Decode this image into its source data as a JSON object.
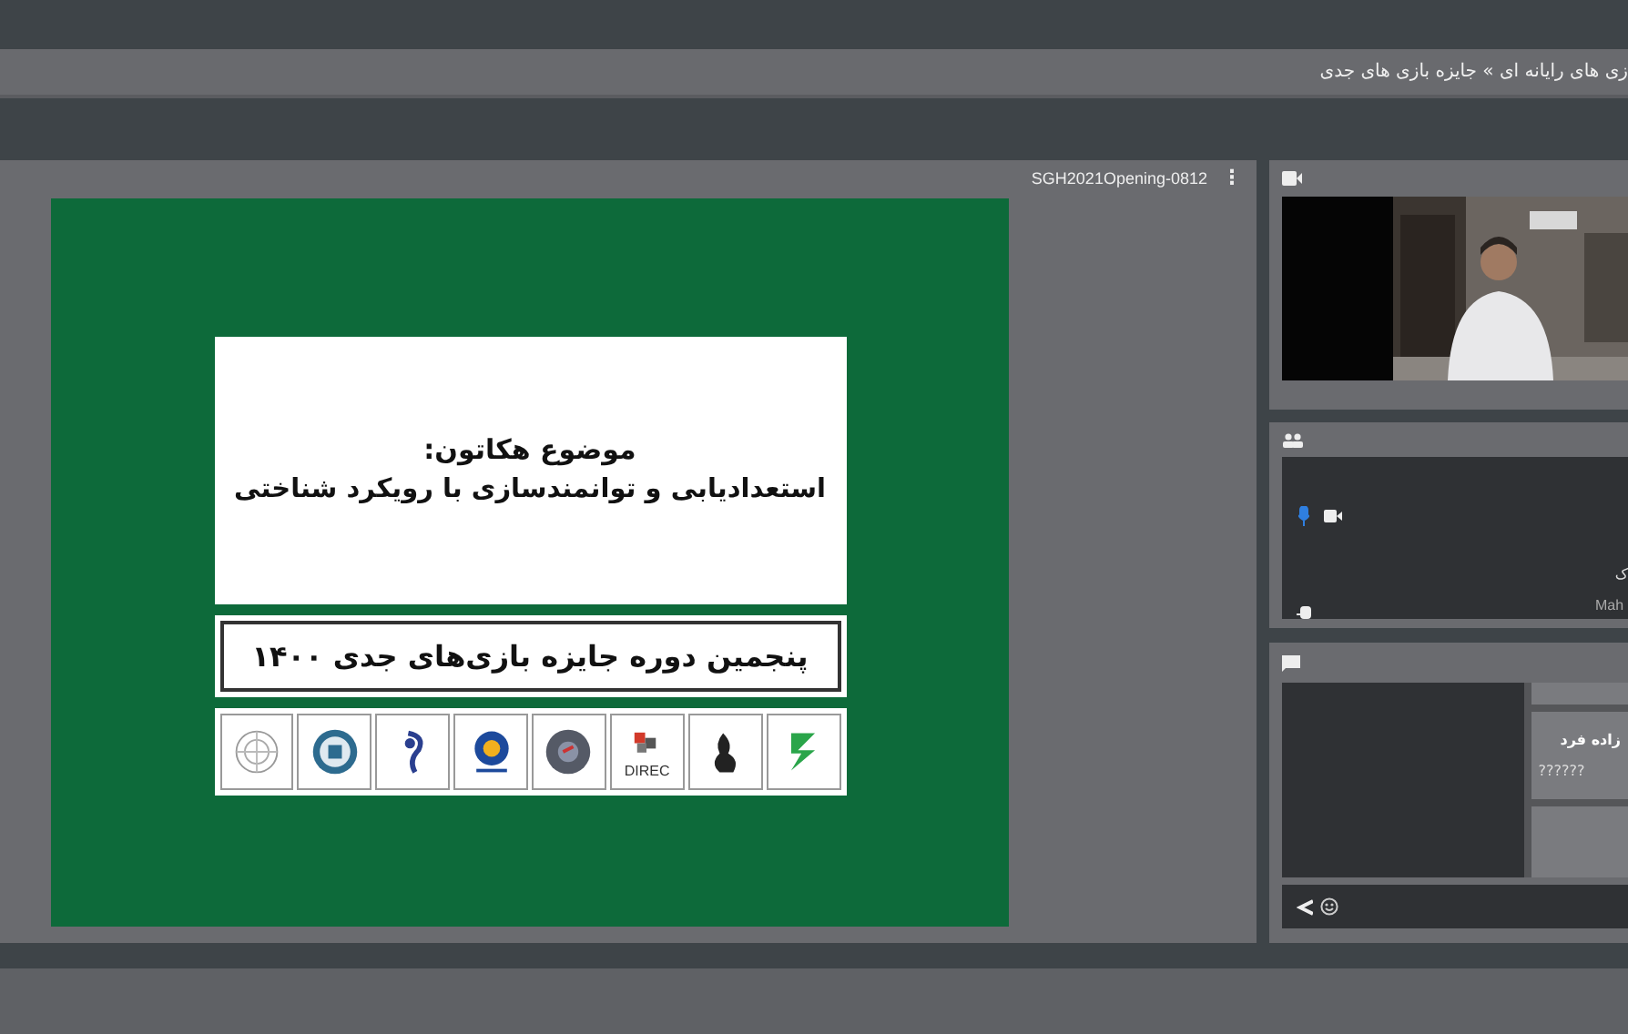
{
  "top_bar": {
    "breadcrumb": "زی های رایانه ای » جایزه بازی های جدی"
  },
  "share_pod": {
    "title": "SGH2021Opening-0812",
    "menu_icon": "⋮",
    "slide": {
      "topic_label": "موضوع هکاتون:",
      "topic": "استعدادیابی و توانمندسازی با رویکرد شناختی",
      "banner": "پنجمین دوره جایزه بازی‌های جدی ۱۴۰۰",
      "logos": [
        {
          "kind": "network"
        },
        {
          "kind": "emblem"
        },
        {
          "kind": "ribbon"
        },
        {
          "kind": "badge"
        },
        {
          "kind": "seal"
        },
        {
          "kind": "puzzle",
          "caption": "DIREC"
        },
        {
          "kind": "vase"
        },
        {
          "kind": "leaf"
        }
      ]
    }
  },
  "attendees_pod": {
    "attendee": {
      "mic_active": true,
      "name": "ک",
      "login": "Mah"
    }
  },
  "chat_pod": {
    "messages": [
      {
        "sender": "زاده فرد",
        "text": "??????"
      }
    ]
  }
}
